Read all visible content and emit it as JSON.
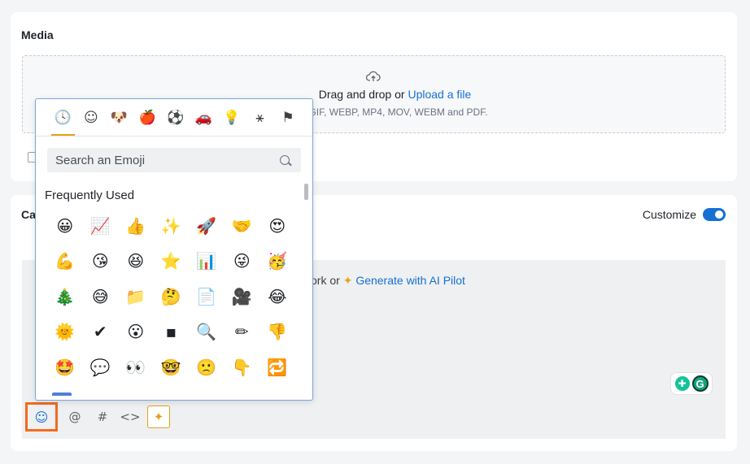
{
  "media": {
    "title": "Media",
    "dropzone": {
      "text": "Drag and drop or",
      "upload_link": "Upload a file",
      "formats": "GIF, WEBP, MP4, MOV, WEBM and PDF."
    }
  },
  "caption": {
    "title_fragment": "Ca",
    "customize_label": "Customize",
    "customize_on": true,
    "prompt_text": "twork or",
    "ai_link": "Generate with AI Pilot"
  },
  "toolbar": {
    "emoji_icon": "☺",
    "mention_icon": "@",
    "hashtag_icon": "#",
    "code_icon": "<>",
    "ai_icon": "✦"
  },
  "emoji_picker": {
    "categories": [
      {
        "name": "recent-icon",
        "glyph": "🕓"
      },
      {
        "name": "smileys-icon",
        "glyph": "☺"
      },
      {
        "name": "animals-icon",
        "glyph": "🐶"
      },
      {
        "name": "food-icon",
        "glyph": "🍎"
      },
      {
        "name": "activities-icon",
        "glyph": "⚽"
      },
      {
        "name": "travel-icon",
        "glyph": "🚗"
      },
      {
        "name": "objects-icon",
        "glyph": "💡"
      },
      {
        "name": "symbols-icon",
        "glyph": "⚹"
      },
      {
        "name": "flags-icon",
        "glyph": "⚑"
      }
    ],
    "search_placeholder": "Search an Emoji",
    "section_title": "Frequently Used",
    "emojis": [
      "😀",
      "📈",
      "👍",
      "✨",
      "🚀",
      "🤝",
      "😍",
      "💪",
      "😘",
      "😆",
      "⭐",
      "📊",
      "😜",
      "🥳",
      "🎄",
      "😅",
      "📁",
      "🤔",
      "📄",
      "🎥",
      "😂",
      "🌞",
      "✔",
      "😮",
      "▪",
      "🔍",
      "✏",
      "👎",
      "🤩",
      "💬",
      "👀",
      "🤓",
      "🙁",
      "👇",
      "🔁"
    ]
  },
  "grammarly": {
    "bulb": "♀",
    "logo": "G"
  }
}
